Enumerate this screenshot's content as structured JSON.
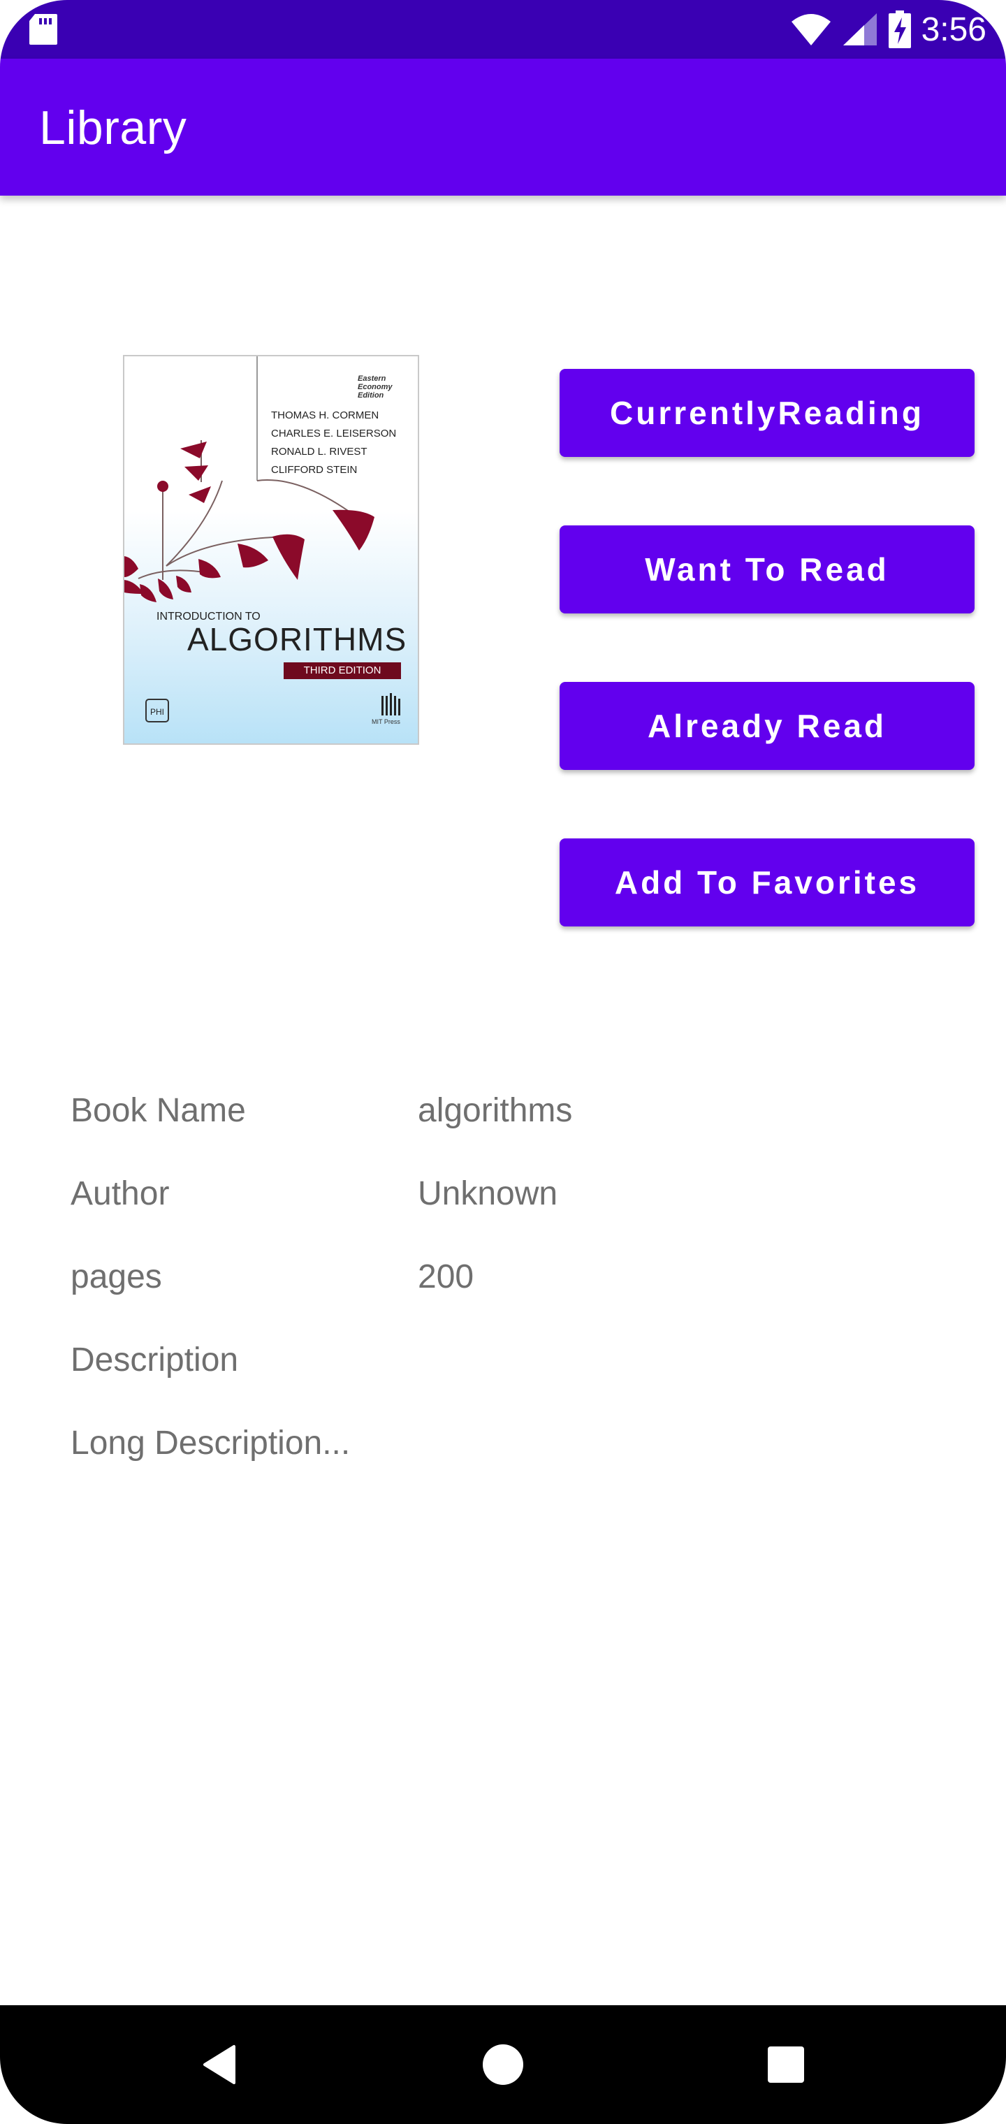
{
  "status_bar": {
    "time": "3:56",
    "icons": [
      "sd-card-icon",
      "wifi-icon",
      "cell-signal-icon",
      "battery-charging-icon"
    ]
  },
  "app_bar": {
    "title": "Library"
  },
  "cover": {
    "authors": [
      "THOMAS H. CORMEN",
      "CHARLES E. LEISERSON",
      "RONALD L. RIVEST",
      "CLIFFORD STEIN"
    ],
    "badge": [
      "Eastern",
      "Economy",
      "Edition"
    ],
    "subtitle": "INTRODUCTION TO",
    "title": "ALGORITHMS",
    "edition": "THIRD EDITION",
    "publisher_left": "PHI",
    "publisher_right": "MIT Press"
  },
  "actions": {
    "currently_reading": "CurrentlyReading",
    "want_to_read": "Want To Read",
    "already_read": "Already Read",
    "add_to_favorites": "Add To Favorites"
  },
  "details": {
    "book_name_label": "Book Name",
    "book_name_value": "algorithms",
    "author_label": "Author",
    "author_value": "Unknown",
    "pages_label": "pages",
    "pages_value": "200",
    "description_label": "Description",
    "long_description": "Long Description..."
  },
  "nav_bar": {
    "icons": [
      "back-icon",
      "home-icon",
      "recents-icon"
    ]
  },
  "colors": {
    "primary": "#6200ee",
    "primary_dark": "#3a00b3",
    "text_secondary": "#6f6f6f",
    "cover_accent": "#8b0a2a"
  }
}
